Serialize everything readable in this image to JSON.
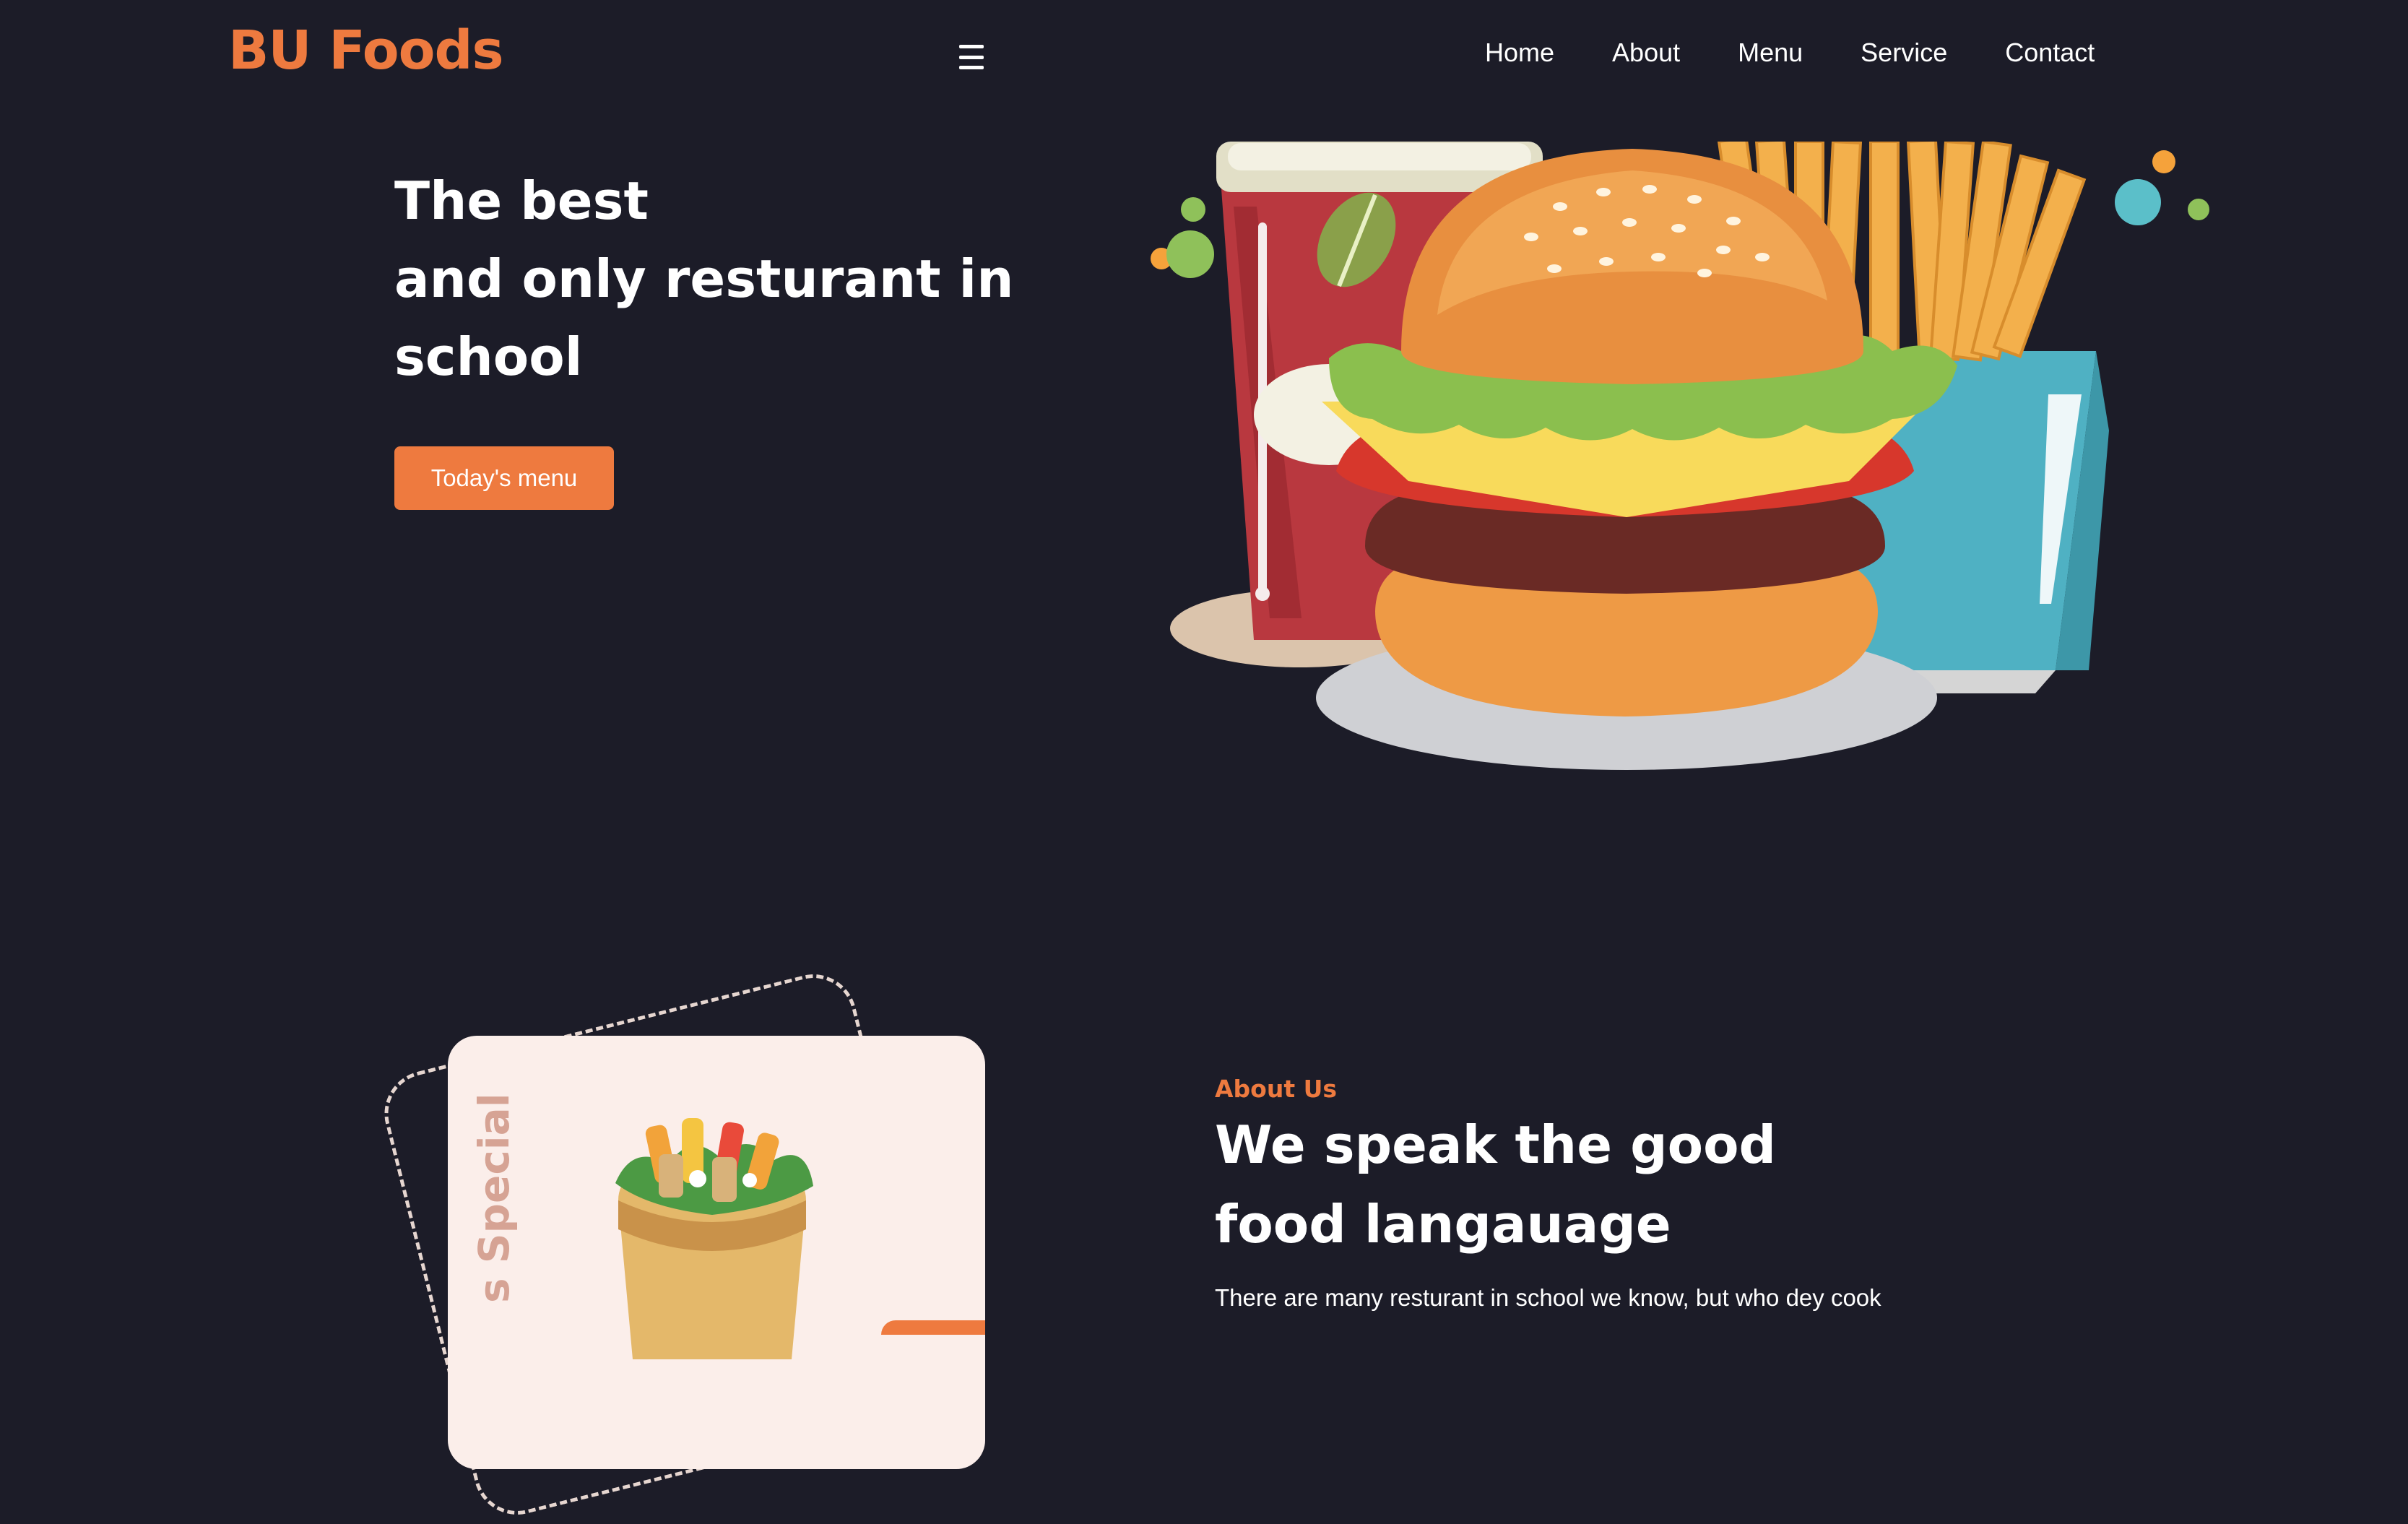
{
  "header": {
    "logo": "BU Foods",
    "menu_icon": "hamburger-menu-icon",
    "nav": [
      {
        "label": "Home"
      },
      {
        "label": "About"
      },
      {
        "label": "Menu"
      },
      {
        "label": "Service"
      },
      {
        "label": "Contact"
      }
    ]
  },
  "hero": {
    "title_lines": [
      "The best",
      "and only resturant in",
      "school"
    ],
    "button_label": "Today's menu",
    "image": "burger-drink-fries-illustration"
  },
  "about": {
    "card_label": "s Special",
    "card_image": "wrap-illustration",
    "kicker": "About Us",
    "title_lines": [
      "We speak the good",
      "food langauage"
    ],
    "text": "There are many resturant in school we know, but who dey cook"
  },
  "colors": {
    "background": "#1c1c28",
    "accent": "#ee7a3f",
    "text": "#ffffff",
    "card_background": "#fbeeea"
  }
}
